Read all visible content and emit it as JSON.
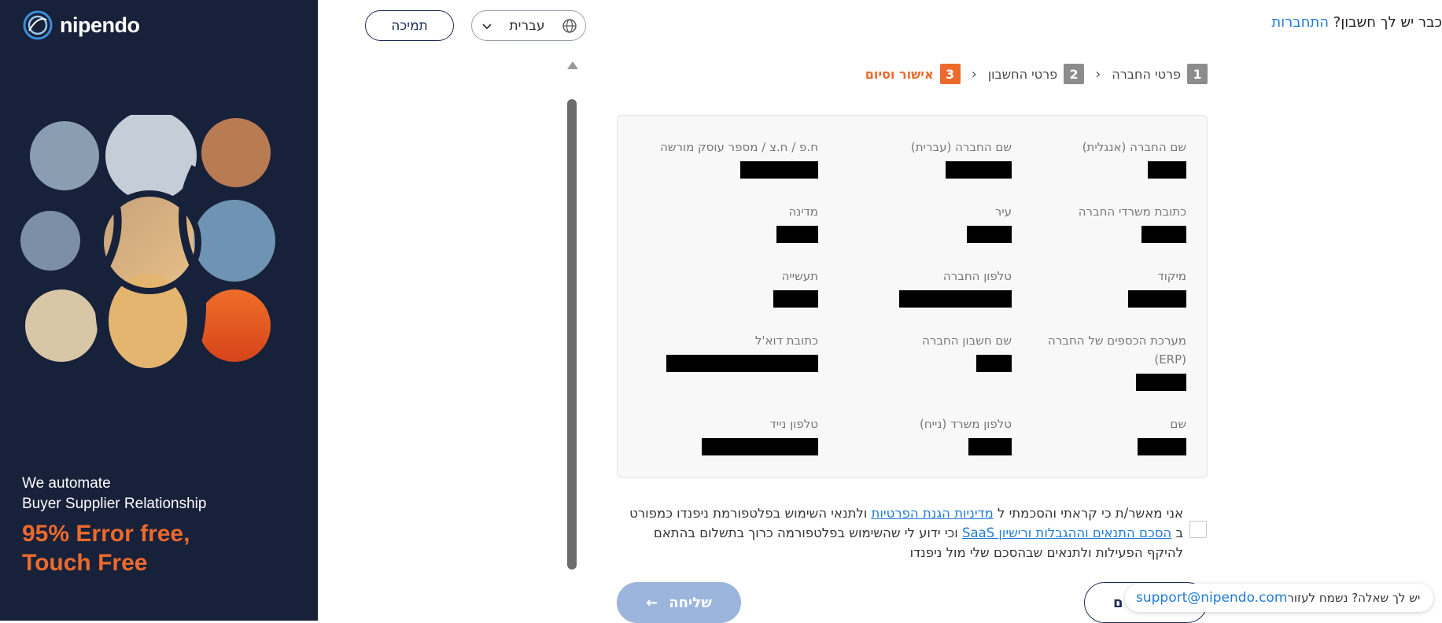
{
  "brand": {
    "name": "nipendo"
  },
  "sidebar": {
    "tagline_line1": "We automate",
    "tagline_line2": "Buyer Supplier Relationship",
    "headline_line1": "95% Error free,",
    "headline_line2": "Touch Free",
    "colors": {
      "background": "#17213a",
      "accent": "#ec6a2c"
    }
  },
  "topbar": {
    "support_button": "תמיכה",
    "language": {
      "selected": "עברית",
      "icon": "globe-icon"
    },
    "login_prompt": "כבר יש לך חשבון?",
    "login_link": "התחברות"
  },
  "stepper": {
    "steps": [
      {
        "num": "1",
        "label": "פרטי החברה",
        "active": false
      },
      {
        "num": "2",
        "label": "פרטי החשבון",
        "active": false
      },
      {
        "num": "3",
        "label": "אישור וסיום",
        "active": true
      }
    ]
  },
  "summary": {
    "fields": [
      {
        "label": "שם החברה (אנגלית)"
      },
      {
        "label": "שם החברה (עברית)"
      },
      {
        "label": "ח.פ / ח.צ / מספר עוסק מורשה"
      },
      {
        "label": "כתובת משרדי החברה"
      },
      {
        "label": "עיר"
      },
      {
        "label": "מדינה"
      },
      {
        "label": "מיקוד"
      },
      {
        "label": "טלפון החברה"
      },
      {
        "label": "תעשייה"
      },
      {
        "label": "מערכת הכספים של החברה (ERP)"
      },
      {
        "label": "שם חשבון החברה"
      },
      {
        "label": "כתובת דוא'ל"
      },
      {
        "label": "שם"
      },
      {
        "label": "טלפון משרד (נייח)"
      },
      {
        "label": "טלפון נייד"
      }
    ]
  },
  "consent": {
    "part1": "אני מאשר/ת כי קראתי והסכמתי ל ",
    "link1": "מדיניות הגנת הפרטיות",
    "part2": " ולתנאי השימוש בפלטפורמת ניפנדו כמפורט ב ",
    "link2": "הסכם התנאים וההגבלות ורישיון SaaS",
    "part3": " וכי ידוע לי שהשימוש בפלטפורמה כרוך בתשלום בהתאם להיקף הפעילות ולתנאים שבהסכם שלי מול ניפנדו"
  },
  "actions": {
    "send": "שליחה",
    "send_arrow": "←",
    "back_visible": "ם"
  },
  "help": {
    "text": "יש לך שאלה? נשמח לעזור",
    "email": "support@nipendo.com"
  }
}
